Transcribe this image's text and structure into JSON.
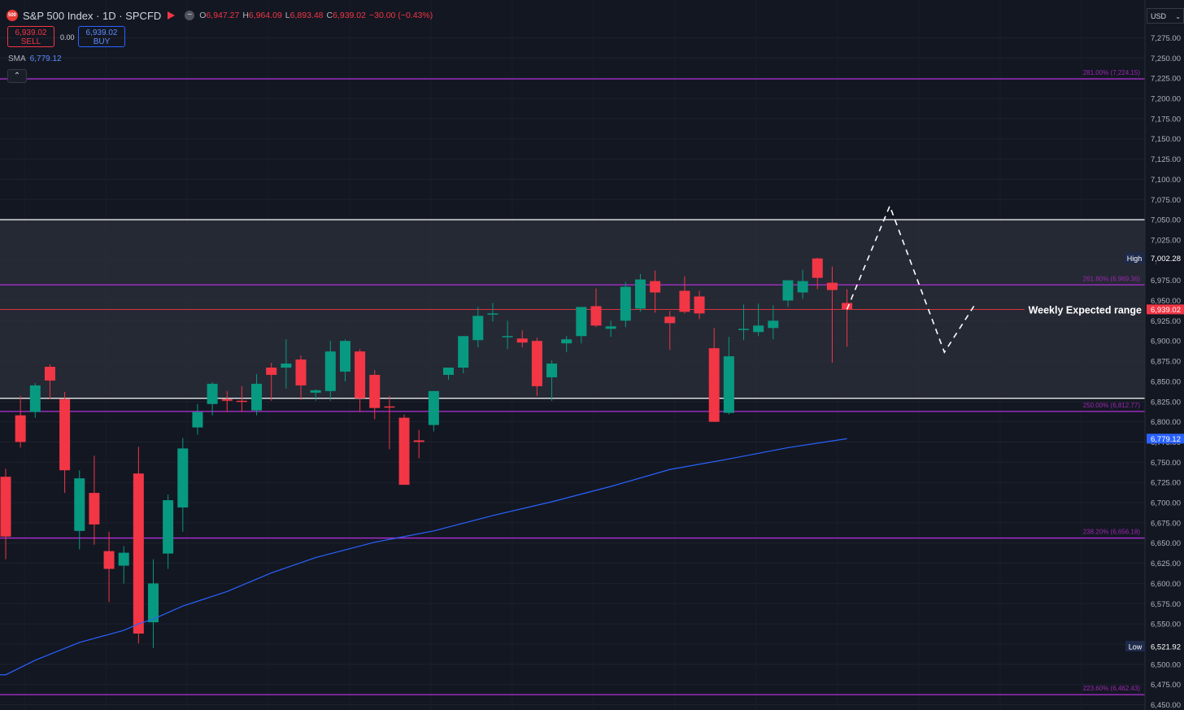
{
  "symbol": {
    "logo_text": "500",
    "title": "S&P 500 Index · 1D · SPCFD",
    "ohlc": [
      {
        "k": "O",
        "v": "6,947.27"
      },
      {
        "k": "H",
        "v": "6,964.09"
      },
      {
        "k": "L",
        "v": "6,893.48"
      },
      {
        "k": "C",
        "v": "6,939.02"
      }
    ],
    "change": "−30.00 (−0.43%)"
  },
  "trade": {
    "sell_price": "6,939.02",
    "sell_label": "SELL",
    "spread": "0.00",
    "buy_price": "6,939.02",
    "buy_label": "BUY"
  },
  "indicator": {
    "name": "SMA",
    "value": "6,779.12"
  },
  "collapse_glyph": "⌃",
  "currency": "USD",
  "colors": {
    "background": "#131722",
    "up": "#089981",
    "down": "#f23645",
    "fib": "#b030d8",
    "sma": "#2962ff",
    "price_line": "#f23645",
    "range_border": "#ffffff"
  },
  "chart_data": {
    "type": "candlestick",
    "ylim": [
      6450,
      7287
    ],
    "y_ticks": [
      6450,
      6475,
      6500,
      6525,
      6550,
      6575,
      6600,
      6625,
      6650,
      6675,
      6700,
      6725,
      6750,
      6775,
      6800,
      6825,
      6850,
      6875,
      6900,
      6925,
      6950,
      6975,
      7000,
      7025,
      7050,
      7075,
      7100,
      7125,
      7150,
      7175,
      7200,
      7225,
      7250,
      7275
    ],
    "candles": [
      {
        "o": 6732,
        "h": 6742,
        "l": 6630,
        "c": 6658
      },
      {
        "o": 6808,
        "h": 6832,
        "l": 6768,
        "c": 6775
      },
      {
        "o": 6812,
        "h": 6848,
        "l": 6805,
        "c": 6845
      },
      {
        "o": 6868,
        "h": 6871,
        "l": 6828,
        "c": 6851
      },
      {
        "o": 6828,
        "h": 6837,
        "l": 6712,
        "c": 6740
      },
      {
        "o": 6665,
        "h": 6740,
        "l": 6642,
        "c": 6730
      },
      {
        "o": 6712,
        "h": 6758,
        "l": 6648,
        "c": 6673
      },
      {
        "o": 6640,
        "h": 6664,
        "l": 6577,
        "c": 6618
      },
      {
        "o": 6622,
        "h": 6646,
        "l": 6600,
        "c": 6638
      },
      {
        "o": 6736,
        "h": 6769,
        "l": 6526,
        "c": 6538
      },
      {
        "o": 6552,
        "h": 6630,
        "l": 6520,
        "c": 6600
      },
      {
        "o": 6637,
        "h": 6710,
        "l": 6618,
        "c": 6703
      },
      {
        "o": 6694,
        "h": 6780,
        "l": 6664,
        "c": 6767
      },
      {
        "o": 6793,
        "h": 6822,
        "l": 6784,
        "c": 6812
      },
      {
        "o": 6822,
        "h": 6849,
        "l": 6808,
        "c": 6847
      },
      {
        "o": 6828,
        "h": 6838,
        "l": 6812,
        "c": 6826
      },
      {
        "o": 6826,
        "h": 6844,
        "l": 6812,
        "c": 6825
      },
      {
        "o": 6814,
        "h": 6859,
        "l": 6808,
        "c": 6847
      },
      {
        "o": 6867,
        "h": 6873,
        "l": 6826,
        "c": 6858
      },
      {
        "o": 6867,
        "h": 6902,
        "l": 6841,
        "c": 6872
      },
      {
        "o": 6877,
        "h": 6882,
        "l": 6827,
        "c": 6845
      },
      {
        "o": 6836,
        "h": 6840,
        "l": 6826,
        "c": 6839
      },
      {
        "o": 6838,
        "h": 6900,
        "l": 6826,
        "c": 6887
      },
      {
        "o": 6862,
        "h": 6902,
        "l": 6850,
        "c": 6900
      },
      {
        "o": 6887,
        "h": 6890,
        "l": 6812,
        "c": 6829
      },
      {
        "o": 6858,
        "h": 6864,
        "l": 6803,
        "c": 6817
      },
      {
        "o": 6819,
        "h": 6832,
        "l": 6766,
        "c": 6818
      },
      {
        "o": 6805,
        "h": 6809,
        "l": 6730,
        "c": 6722
      },
      {
        "o": 6777,
        "h": 6790,
        "l": 6755,
        "c": 6775
      },
      {
        "o": 6796,
        "h": 6836,
        "l": 6788,
        "c": 6838
      },
      {
        "o": 6858,
        "h": 6867,
        "l": 6852,
        "c": 6867
      },
      {
        "o": 6867,
        "h": 6906,
        "l": 6860,
        "c": 6906
      },
      {
        "o": 6901,
        "h": 6942,
        "l": 6892,
        "c": 6931
      },
      {
        "o": 6934,
        "h": 6947,
        "l": 6924,
        "c": 6934
      },
      {
        "o": 6905,
        "h": 6925,
        "l": 6890,
        "c": 6906
      },
      {
        "o": 6903,
        "h": 6913,
        "l": 6892,
        "c": 6898
      },
      {
        "o": 6900,
        "h": 6904,
        "l": 6832,
        "c": 6844
      },
      {
        "o": 6855,
        "h": 6876,
        "l": 6826,
        "c": 6872
      },
      {
        "o": 6897,
        "h": 6906,
        "l": 6886,
        "c": 6902
      },
      {
        "o": 6906,
        "h": 6940,
        "l": 6897,
        "c": 6942
      },
      {
        "o": 6943,
        "h": 6965,
        "l": 6917,
        "c": 6919
      },
      {
        "o": 6915,
        "h": 6925,
        "l": 6905,
        "c": 6918
      },
      {
        "o": 6925,
        "h": 6973,
        "l": 6917,
        "c": 6967
      },
      {
        "o": 6940,
        "h": 6983,
        "l": 6936,
        "c": 6976
      },
      {
        "o": 6974,
        "h": 6987,
        "l": 6935,
        "c": 6960
      },
      {
        "o": 6930,
        "h": 6937,
        "l": 6889,
        "c": 6922
      },
      {
        "o": 6962,
        "h": 6980,
        "l": 6934,
        "c": 6936
      },
      {
        "o": 6955,
        "h": 6962,
        "l": 6927,
        "c": 6934
      },
      {
        "o": 6891,
        "h": 6916,
        "l": 6800,
        "c": 6800
      },
      {
        "o": 6811,
        "h": 6905,
        "l": 6809,
        "c": 6881
      },
      {
        "o": 6915,
        "h": 6945,
        "l": 6901,
        "c": 6915
      },
      {
        "o": 6911,
        "h": 6946,
        "l": 6906,
        "c": 6919
      },
      {
        "o": 6916,
        "h": 6944,
        "l": 6902,
        "c": 6925
      },
      {
        "o": 6950,
        "h": 6968,
        "l": 6942,
        "c": 6975
      },
      {
        "o": 6960,
        "h": 6988,
        "l": 6952,
        "c": 6974
      },
      {
        "o": 7002,
        "h": 7003,
        "l": 6964,
        "c": 6978
      },
      {
        "o": 6972,
        "h": 6992,
        "l": 6873,
        "c": 6963
      },
      {
        "o": 6947,
        "h": 6964,
        "l": 6893,
        "c": 6939
      }
    ],
    "sma": [
      {
        "c": 0,
        "v": 6487
      },
      {
        "c": 2,
        "v": 6505
      },
      {
        "c": 5,
        "v": 6527
      },
      {
        "c": 8,
        "v": 6542
      },
      {
        "c": 9,
        "v": 6550
      },
      {
        "c": 10,
        "v": 6556
      },
      {
        "c": 12,
        "v": 6572
      },
      {
        "c": 15,
        "v": 6590
      },
      {
        "c": 18,
        "v": 6613
      },
      {
        "c": 21,
        "v": 6632
      },
      {
        "c": 25,
        "v": 6651
      },
      {
        "c": 29,
        "v": 6665
      },
      {
        "c": 33,
        "v": 6684
      },
      {
        "c": 37,
        "v": 6701
      },
      {
        "c": 41,
        "v": 6720
      },
      {
        "c": 45,
        "v": 6741
      },
      {
        "c": 49,
        "v": 6754
      },
      {
        "c": 53,
        "v": 6768
      },
      {
        "c": 57,
        "v": 6779.12
      }
    ],
    "expected_range": {
      "low": 6829,
      "high": 7050
    },
    "range_label": "Weekly Expected range",
    "fib_levels": [
      {
        "label": "281.00% (7,224.15)",
        "value": 7224.15
      },
      {
        "label": "261.80% (6,969.36)",
        "value": 6969.36
      },
      {
        "label": "250.00% (6,812.77)",
        "value": 6812.77
      },
      {
        "label": "238.20% (6,656.18)",
        "value": 6656.18
      },
      {
        "label": "223.60% (6,462.43)",
        "value": 6462.43
      }
    ],
    "current_price": {
      "value": 6939.02,
      "label": "6,939.02"
    },
    "sma_last": {
      "value": 6779.12,
      "label": "6,779.12"
    },
    "high_marker": {
      "tag": "High",
      "value": 7002.28,
      "label": "7,002.28"
    },
    "low_marker": {
      "tag": "Low",
      "value": 6521.92,
      "label": "6,521.92"
    },
    "projection": [
      {
        "c": 57,
        "v": 6939
      },
      {
        "c": 59.9,
        "v": 7067
      },
      {
        "c": 63.6,
        "v": 6886
      },
      {
        "c": 65.6,
        "v": 6943
      }
    ]
  }
}
